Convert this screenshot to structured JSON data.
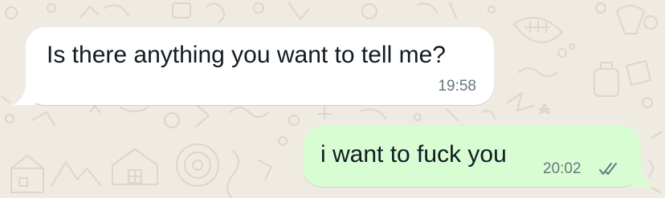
{
  "colors": {
    "wallpaper": "#efeae2",
    "incoming_bubble": "#ffffff",
    "outgoing_bubble": "#d9fdd3",
    "message_text": "#111b21",
    "timestamp_text": "#667781",
    "read_ticks": "#667781"
  },
  "messages": [
    {
      "direction": "incoming",
      "text": "Is there anything you want to tell me?",
      "time": "19:58"
    },
    {
      "direction": "outgoing",
      "text": "i want to fuck you",
      "time": "20:02",
      "status_icon": "double-check-icon"
    }
  ]
}
